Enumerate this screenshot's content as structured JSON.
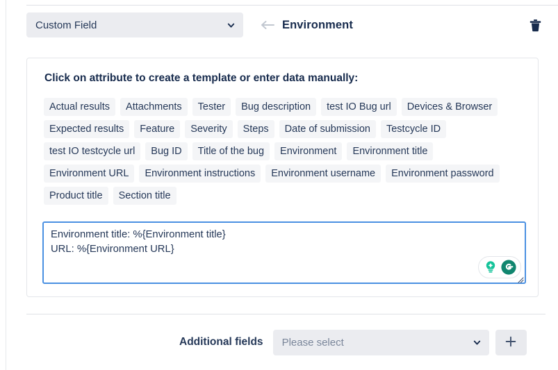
{
  "header": {
    "field_select_value": "Custom Field",
    "back_icon": "arrow-left-icon",
    "title": "Environment",
    "delete_icon": "trash-icon",
    "chevron_icon": "chevron-down-icon"
  },
  "card": {
    "instruction": "Click on attribute to create a template or enter data manually:",
    "attributes": [
      "Actual results",
      "Attachments",
      "Tester",
      "Bug description",
      "test IO Bug url",
      "Devices & Browser",
      "Expected results",
      "Feature",
      "Severity",
      "Steps",
      "Date of submission",
      "Testcycle ID",
      "test IO testcycle url",
      "Bug ID",
      "Title of the bug",
      "Environment",
      "Environment title",
      "Environment URL",
      "Environment instructions",
      "Environment username",
      "Environment password",
      "Product title",
      "Section title"
    ],
    "template_value": "Environment title: %{Environment title}\nURL: %{Environment URL}",
    "template_placeholder": "",
    "assistant": {
      "bulb_icon": "lightbulb-icon",
      "logo_icon": "grammarly-logo-icon"
    },
    "resize_icon": "resize-grip-icon"
  },
  "additional": {
    "label": "Additional fields",
    "select_placeholder": "Please select",
    "select_value": "Please select",
    "add_label": "+",
    "add_icon": "plus-icon",
    "chevron_icon": "chevron-down-icon"
  },
  "colors": {
    "text_dark": "#172b4d",
    "text_body": "#253858",
    "placeholder": "#7a869a",
    "chip_bg": "#f4f5f7",
    "control_bg": "#ebecf0",
    "focus_border": "#4a90e2",
    "grammarly_green": "#15c39a",
    "grammarly_dark_green": "#11866f"
  }
}
